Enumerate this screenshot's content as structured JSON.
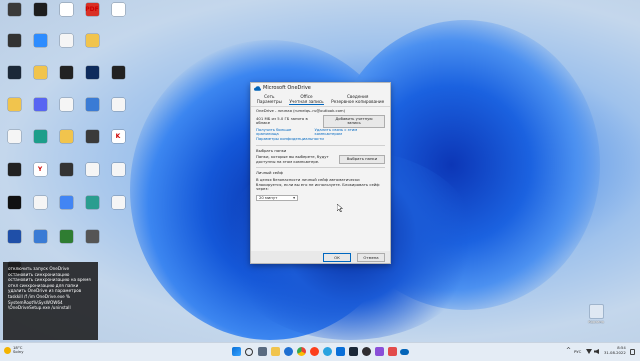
{
  "desktop": {
    "icons": [
      {
        "label": "",
        "color": "#3a3a3a"
      },
      {
        "label": "",
        "color": "#1e1e1e"
      },
      {
        "label": "",
        "color": "#ffffff"
      },
      {
        "label": "PDF",
        "color": "#d93025"
      },
      {
        "label": "",
        "color": "#ffffff"
      },
      {
        "label": "",
        "color": "#333333"
      },
      {
        "label": "",
        "color": "#2d8cff"
      },
      {
        "label": "",
        "color": "#f5f5f5"
      },
      {
        "label": "",
        "color": "#f1c44d"
      },
      {
        "label": "",
        "color": "#1b2838"
      },
      {
        "label": "",
        "color": "#f1c44d"
      },
      {
        "label": "",
        "color": "#222222"
      },
      {
        "label": "",
        "color": "#0e2b5c"
      },
      {
        "label": "",
        "color": "#222222"
      },
      {
        "label": "",
        "color": "#f1c44d"
      },
      {
        "label": "",
        "color": "#5865f2"
      },
      {
        "label": "",
        "color": "#f5f5f5"
      },
      {
        "label": "",
        "color": "#3a7bd5"
      },
      {
        "label": "",
        "color": "#f5f5f5"
      },
      {
        "label": "",
        "color": "#f5f5f5"
      },
      {
        "label": "",
        "color": "#1d9e8a"
      },
      {
        "label": "",
        "color": "#f1c44d"
      },
      {
        "label": "",
        "color": "#3a3a3a"
      },
      {
        "label": "K",
        "color": "#ffffff"
      },
      {
        "label": "",
        "color": "#222222"
      },
      {
        "label": "Y",
        "color": "#ffffff"
      },
      {
        "label": "",
        "color": "#333333"
      },
      {
        "label": "",
        "color": "#f5f5f5"
      },
      {
        "label": "",
        "color": "#f5f5f5"
      },
      {
        "label": "",
        "color": "#111111"
      },
      {
        "label": "",
        "color": "#f5f5f5"
      },
      {
        "label": "",
        "color": "#4285f4"
      },
      {
        "label": "",
        "color": "#2a9d8f"
      },
      {
        "label": "",
        "color": "#f5f5f5"
      },
      {
        "label": "",
        "color": "#1f4fa8"
      },
      {
        "label": "",
        "color": "#3a7bd5"
      },
      {
        "label": "",
        "color": "#2f7d32"
      },
      {
        "label": "",
        "color": "#555555"
      },
      {
        "label": "",
        "color": "#222222"
      }
    ],
    "recycle_label": "Корзина"
  },
  "dialog": {
    "title": "Microsoft OneDrive",
    "tabs": [
      {
        "label": "Сеть"
      },
      {
        "label": "Office"
      },
      {
        "label": "Сведения"
      },
      {
        "label": "Параметры"
      },
      {
        "label": "Учетная запись"
      },
      {
        "label": "Резервное копирование"
      }
    ],
    "account_line": "OneDrive - личная (rumelqs..ru@outlook.com)",
    "storage": "401 МБ из 5.0 ГБ занято в облаке",
    "add_account": "Добавить учетную запись",
    "links": [
      "Получить больше хранилища",
      "Удалить связь с этим компьютером",
      "Параметры конфиденциальности"
    ],
    "choose_folders_heading": "Выбрать папки",
    "choose_folders_text": "Папки, которые вы выберете, будут доступны на этом компьютере.",
    "choose_folders_button": "Выбрать папки",
    "vault_heading": "Личный сейф",
    "vault_text": "В целях безопасности личный сейф автоматически блокируется, если вы его не используете. Блокировать сейф через:",
    "vault_select": "20 минут",
    "ok": "ОК",
    "cancel": "Отмена"
  },
  "notification": {
    "lines": [
      "отключить запуск OneDrive",
      "остановить синхронизацию",
      "остановить синхронизацию на время",
      "откл синхронизацию для папки",
      "удалить OneDrive из параметров",
      "taskkill /f /im OneDrive.exe %",
      "SystemRoot%\\SysWOW64",
      "\\OneDriveSetup.exe /uninstall"
    ]
  },
  "taskbar": {
    "weather_temp": "18°C",
    "weather_text": "Solny",
    "time": "8:54",
    "date": "31.08.2022",
    "lang": "РУС"
  },
  "colors": {
    "accent": "#0067c0",
    "onedrive": "#0364b8"
  }
}
